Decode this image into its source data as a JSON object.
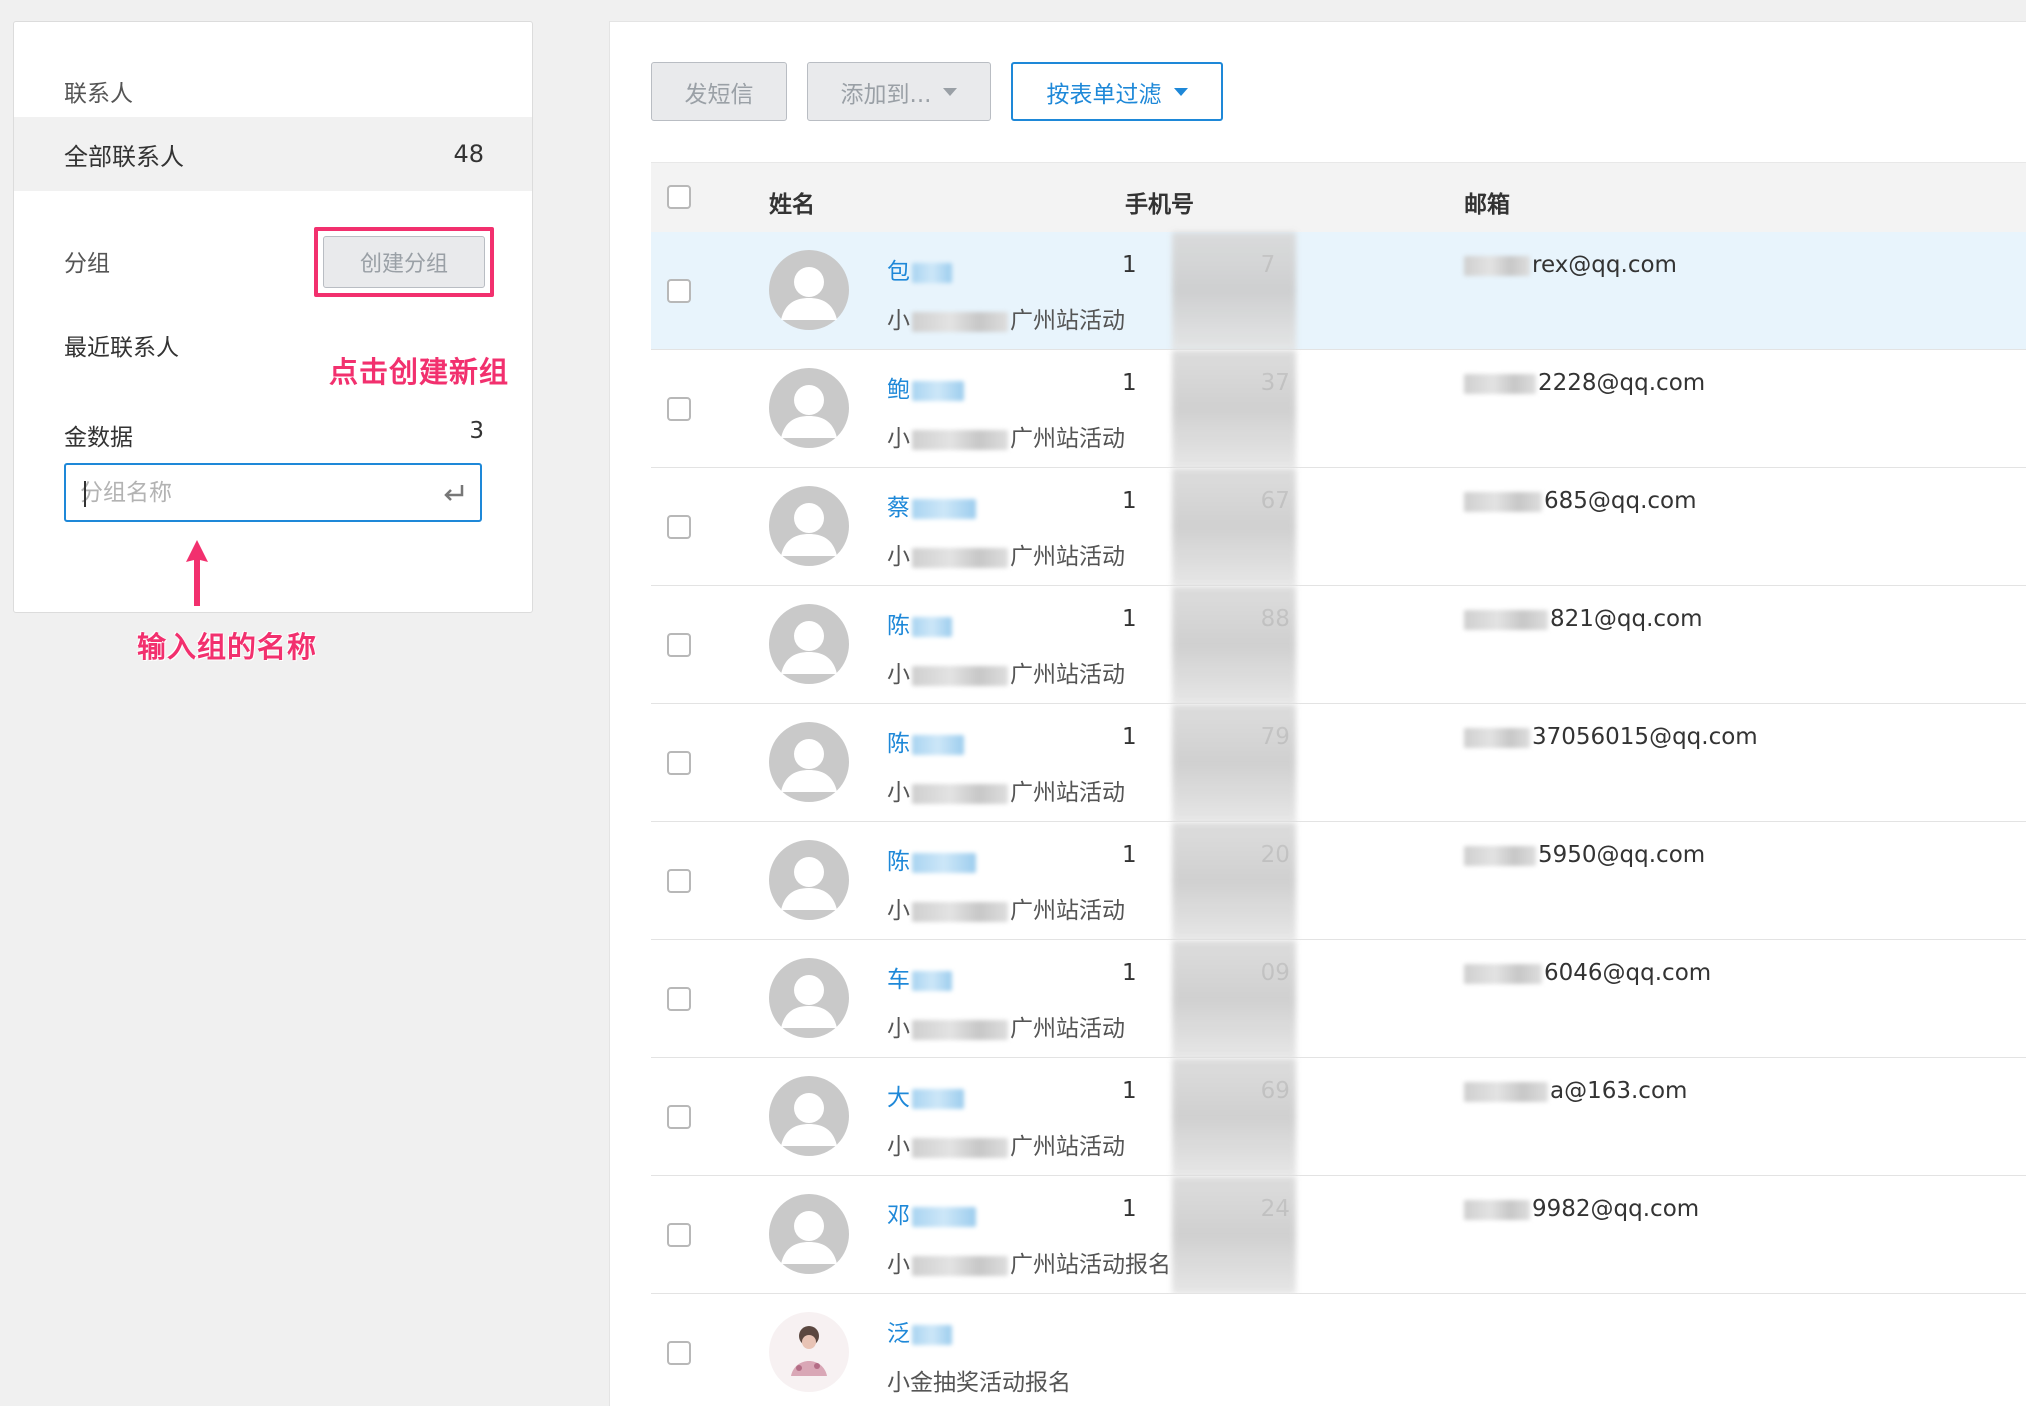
{
  "sidebar": {
    "title": "联系人",
    "all_contacts": {
      "label": "全部联系人",
      "count": "48"
    },
    "group_label": "分组",
    "create_group_button": "创建分组",
    "recent_contacts": "最近联系人",
    "groups": [
      {
        "label": "金数据",
        "count": "3"
      }
    ],
    "group_name_placeholder": "分组名称",
    "annotation_create": "点击创建新组",
    "annotation_input": "输入组的名称"
  },
  "toolbar": {
    "send_sms": "发短信",
    "add_to": "添加到...",
    "filter_by_form": "按表单过滤"
  },
  "table": {
    "columns": [
      "姓名",
      "手机号",
      "邮箱"
    ],
    "rows": [
      {
        "name": "包",
        "source_prefix": "小",
        "source_suffix": "广州站活动",
        "phone_first": "1",
        "phone_last": "7",
        "email_visible": "rex@qq.com",
        "selected": true
      },
      {
        "name": "鲍",
        "source_prefix": "小",
        "source_suffix": "广州站活动",
        "phone_first": "1",
        "phone_last": "37",
        "email_visible": "2228@qq.com",
        "selected": false
      },
      {
        "name": "蔡",
        "source_prefix": "小",
        "source_suffix": "广州站活动",
        "phone_first": "1",
        "phone_last": "67",
        "email_visible": "685@qq.com",
        "selected": false
      },
      {
        "name": "陈",
        "source_prefix": "小",
        "source_suffix": "广州站活动",
        "phone_first": "1",
        "phone_last": "88",
        "email_visible": "821@qq.com",
        "selected": false
      },
      {
        "name": "陈",
        "source_prefix": "小",
        "source_suffix": "广州站活动",
        "phone_first": "1",
        "phone_last": "79",
        "email_visible": "37056015@qq.com",
        "selected": false
      },
      {
        "name": "陈",
        "source_prefix": "小",
        "source_suffix": "广州站活动",
        "phone_first": "1",
        "phone_last": "20",
        "email_visible": "5950@qq.com",
        "selected": false
      },
      {
        "name": "车",
        "source_prefix": "小",
        "source_suffix": "广州站活动",
        "phone_first": "1",
        "phone_last": "09",
        "email_visible": "6046@qq.com",
        "selected": false
      },
      {
        "name": "大",
        "source_prefix": "小",
        "source_suffix": "广州站活动",
        "phone_first": "1",
        "phone_last": "69",
        "email_visible": "a@163.com",
        "selected": false
      },
      {
        "name": "邓",
        "source_prefix": "小",
        "source_suffix": "广州站活动报名",
        "phone_first": "1",
        "phone_last": "24",
        "email_visible": "9982@qq.com",
        "selected": false
      },
      {
        "name": "泛",
        "source_prefix": "",
        "source_suffix": "小金抽奖活动报名",
        "phone_first": "",
        "phone_last": "",
        "email_visible": "",
        "selected": false,
        "photo_avatar": true
      }
    ]
  },
  "colors": {
    "accent": "#1e88d8",
    "annotation": "#f2306e",
    "selected_row": "#e8f4fc"
  }
}
